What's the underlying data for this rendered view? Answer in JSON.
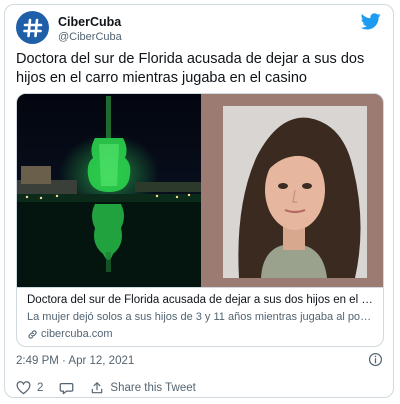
{
  "author": {
    "display_name": "CiberCuba",
    "handle": "@CiberCuba",
    "avatar_icon": "hashtag-logo-icon",
    "avatar_color": "#1f5fa8"
  },
  "tweet": {
    "text": "Doctora del sur de Florida acusada de dejar a sus dos hijos en el carro mientras jugaba en el casino",
    "timestamp": "2:49 PM · Apr 12, 2021"
  },
  "card": {
    "title": "Doctora del sur de Florida acusada de dejar a sus dos hijos en el carro mi...",
    "description": "La mujer dejó solos a sus hijos de 3 y 11 años mientras jugaba al poker.",
    "domain": "cibercuba.com"
  },
  "actions": {
    "like_count": "2",
    "share_label": "Share this Tweet"
  },
  "colors": {
    "twitter_blue": "#1d9bf0",
    "secondary_text": "#536471",
    "border": "#cfd9de"
  }
}
